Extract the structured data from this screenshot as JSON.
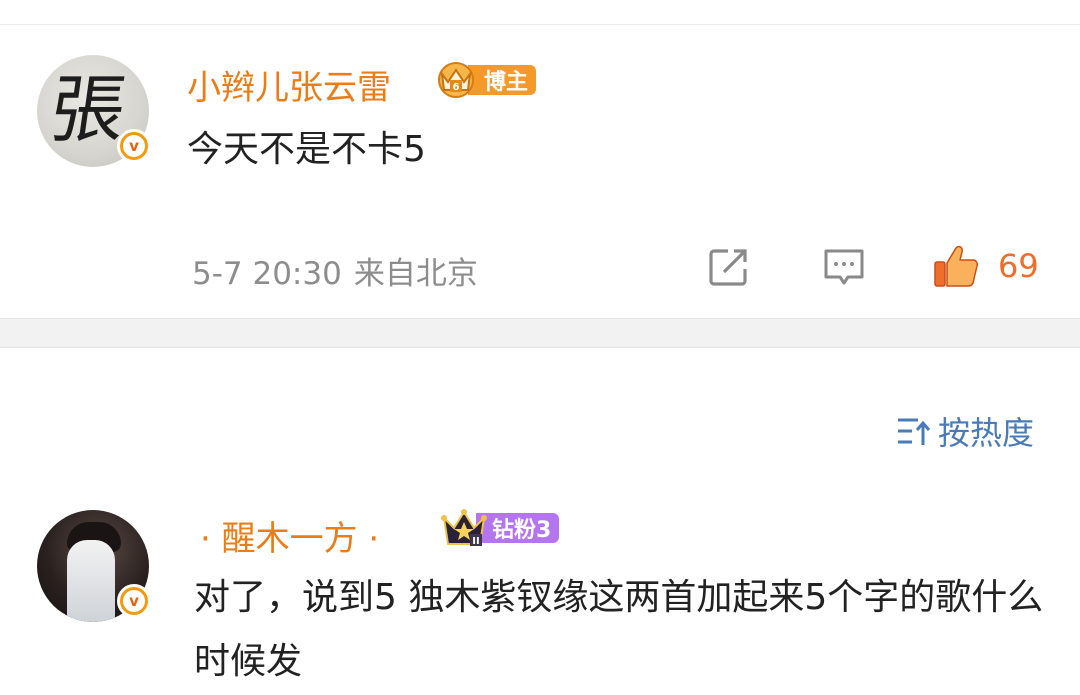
{
  "comment1": {
    "username": "小辫儿张云雷",
    "avatar_glyph": "張",
    "fan_badge": "博主",
    "text": "今天不是不卡5",
    "time": "5-7 20:30",
    "location": "来自北京",
    "like_count": "69",
    "icons": [
      "share-icon",
      "comment-icon",
      "like-icon"
    ]
  },
  "sort": {
    "label": "按热度",
    "icon": "sort-icon"
  },
  "comment2": {
    "username": "· 醒木一方 ·",
    "fan_badge": "钻粉3",
    "text": "对了，说到5 独木紫钗缘这两首加起来5个字的歌什么时候发"
  },
  "colors": {
    "username": "#eb7d17",
    "like_active": "#f06d2b",
    "sort_link": "#4a7ab8",
    "badge_blogger": "#f39a2a",
    "badge_diamond_fan": "#b574f0"
  }
}
